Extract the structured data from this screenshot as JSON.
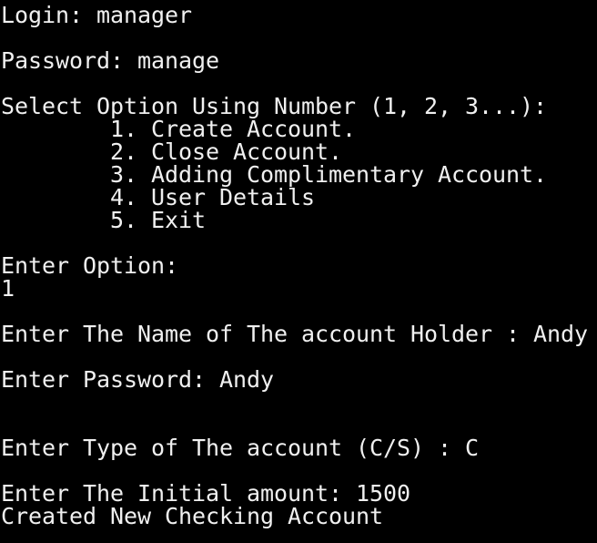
{
  "colors": {
    "background": "#000000",
    "foreground": "#f0f0f0"
  },
  "console": {
    "login_line": "Login: manager",
    "password_line": "Password: manage",
    "select_prompt": "Select Option Using Number (1, 2, 3...):",
    "menu": [
      "        1. Create Account.",
      "        2. Close Account.",
      "        3. Adding Complimentary Account.",
      "        4. User Details",
      "        5. Exit"
    ],
    "enter_option_prompt": "Enter Option:",
    "option_value": "1",
    "account_holder_line": "Enter The Name of The account Holder : Andy",
    "enter_password_line": "Enter Password: Andy",
    "account_type_line": "Enter Type of The account (C/S) : C",
    "initial_amount_line": "Enter The Initial amount: 1500",
    "result_line": "Created New Checking Account"
  }
}
